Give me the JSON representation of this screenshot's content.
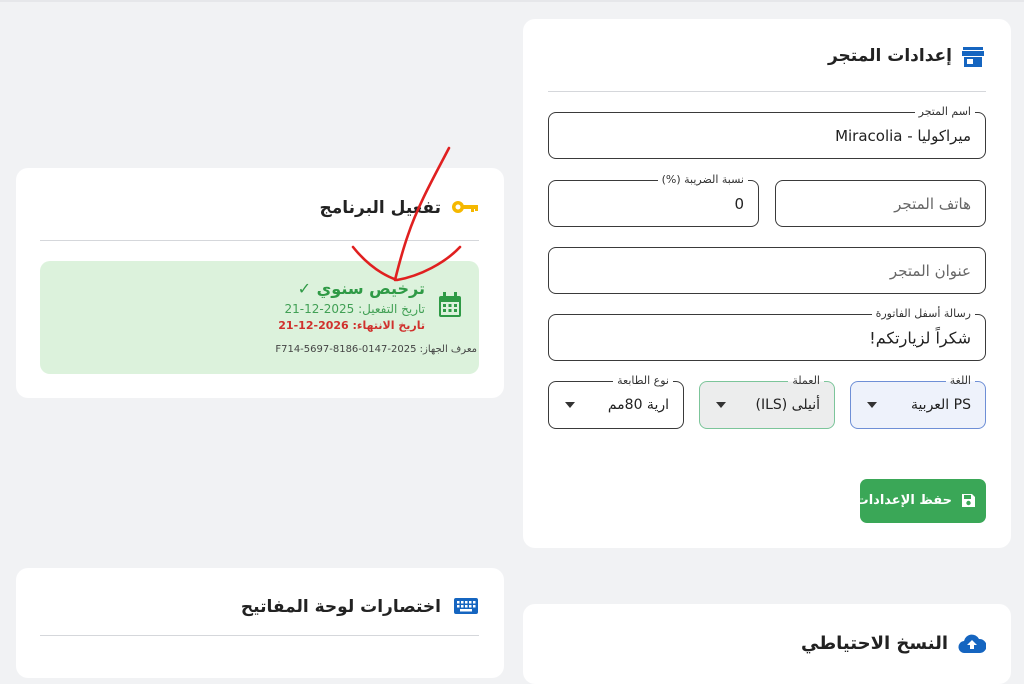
{
  "colors": {
    "primary_blue": "#1565c0",
    "success_green": "#3aa757",
    "license_bg": "#dcf2dc",
    "expiry_red": "#d0312d",
    "key_yellow": "#f5b800"
  },
  "store_settings": {
    "title": "إعدادات المتجر",
    "icon": "store-icon",
    "store_name": {
      "label": "اسم المتجر",
      "value": "ميراكوليا - Miracolia"
    },
    "tax_rate": {
      "label": "نسبة الضريبة (%)",
      "value": "0"
    },
    "store_phone": {
      "placeholder": "هاتف المتجر"
    },
    "store_address": {
      "placeholder": "عنوان المتجر"
    },
    "invoice_footer": {
      "label": "رسالة أسفل الفاتورة",
      "value": "شكراً لزيارتكم!"
    },
    "language": {
      "label": "اللغة",
      "value": "PS العربية"
    },
    "currency": {
      "label": "العملة",
      "value": "أنيلى (ILS)"
    },
    "printer_type": {
      "label": "نوع الطابعة",
      "value": "ارية 80مم"
    },
    "save_button": {
      "label": "حفظ الإعدادات",
      "icon": "floppy-disk-icon"
    }
  },
  "activation": {
    "title": "تفعيل البرنامج",
    "icon": "key-icon",
    "license_type": "ترخيص سنوي ✓",
    "activation_date": "تاريخ التفعيل: 2025-12-21",
    "expiry_date": "تاريخ الانتهاء: 2026-12-21",
    "device_id": "معرف الجهاز: 2025-0147-F714-5697-8186",
    "calendar_icon": "calendar-icon"
  },
  "shortcuts": {
    "title": "اختصارات لوحة المفاتيح",
    "icon": "keyboard-icon"
  },
  "backup": {
    "title": "النسخ الاحتياطي",
    "icon": "cloud-upload-icon"
  }
}
